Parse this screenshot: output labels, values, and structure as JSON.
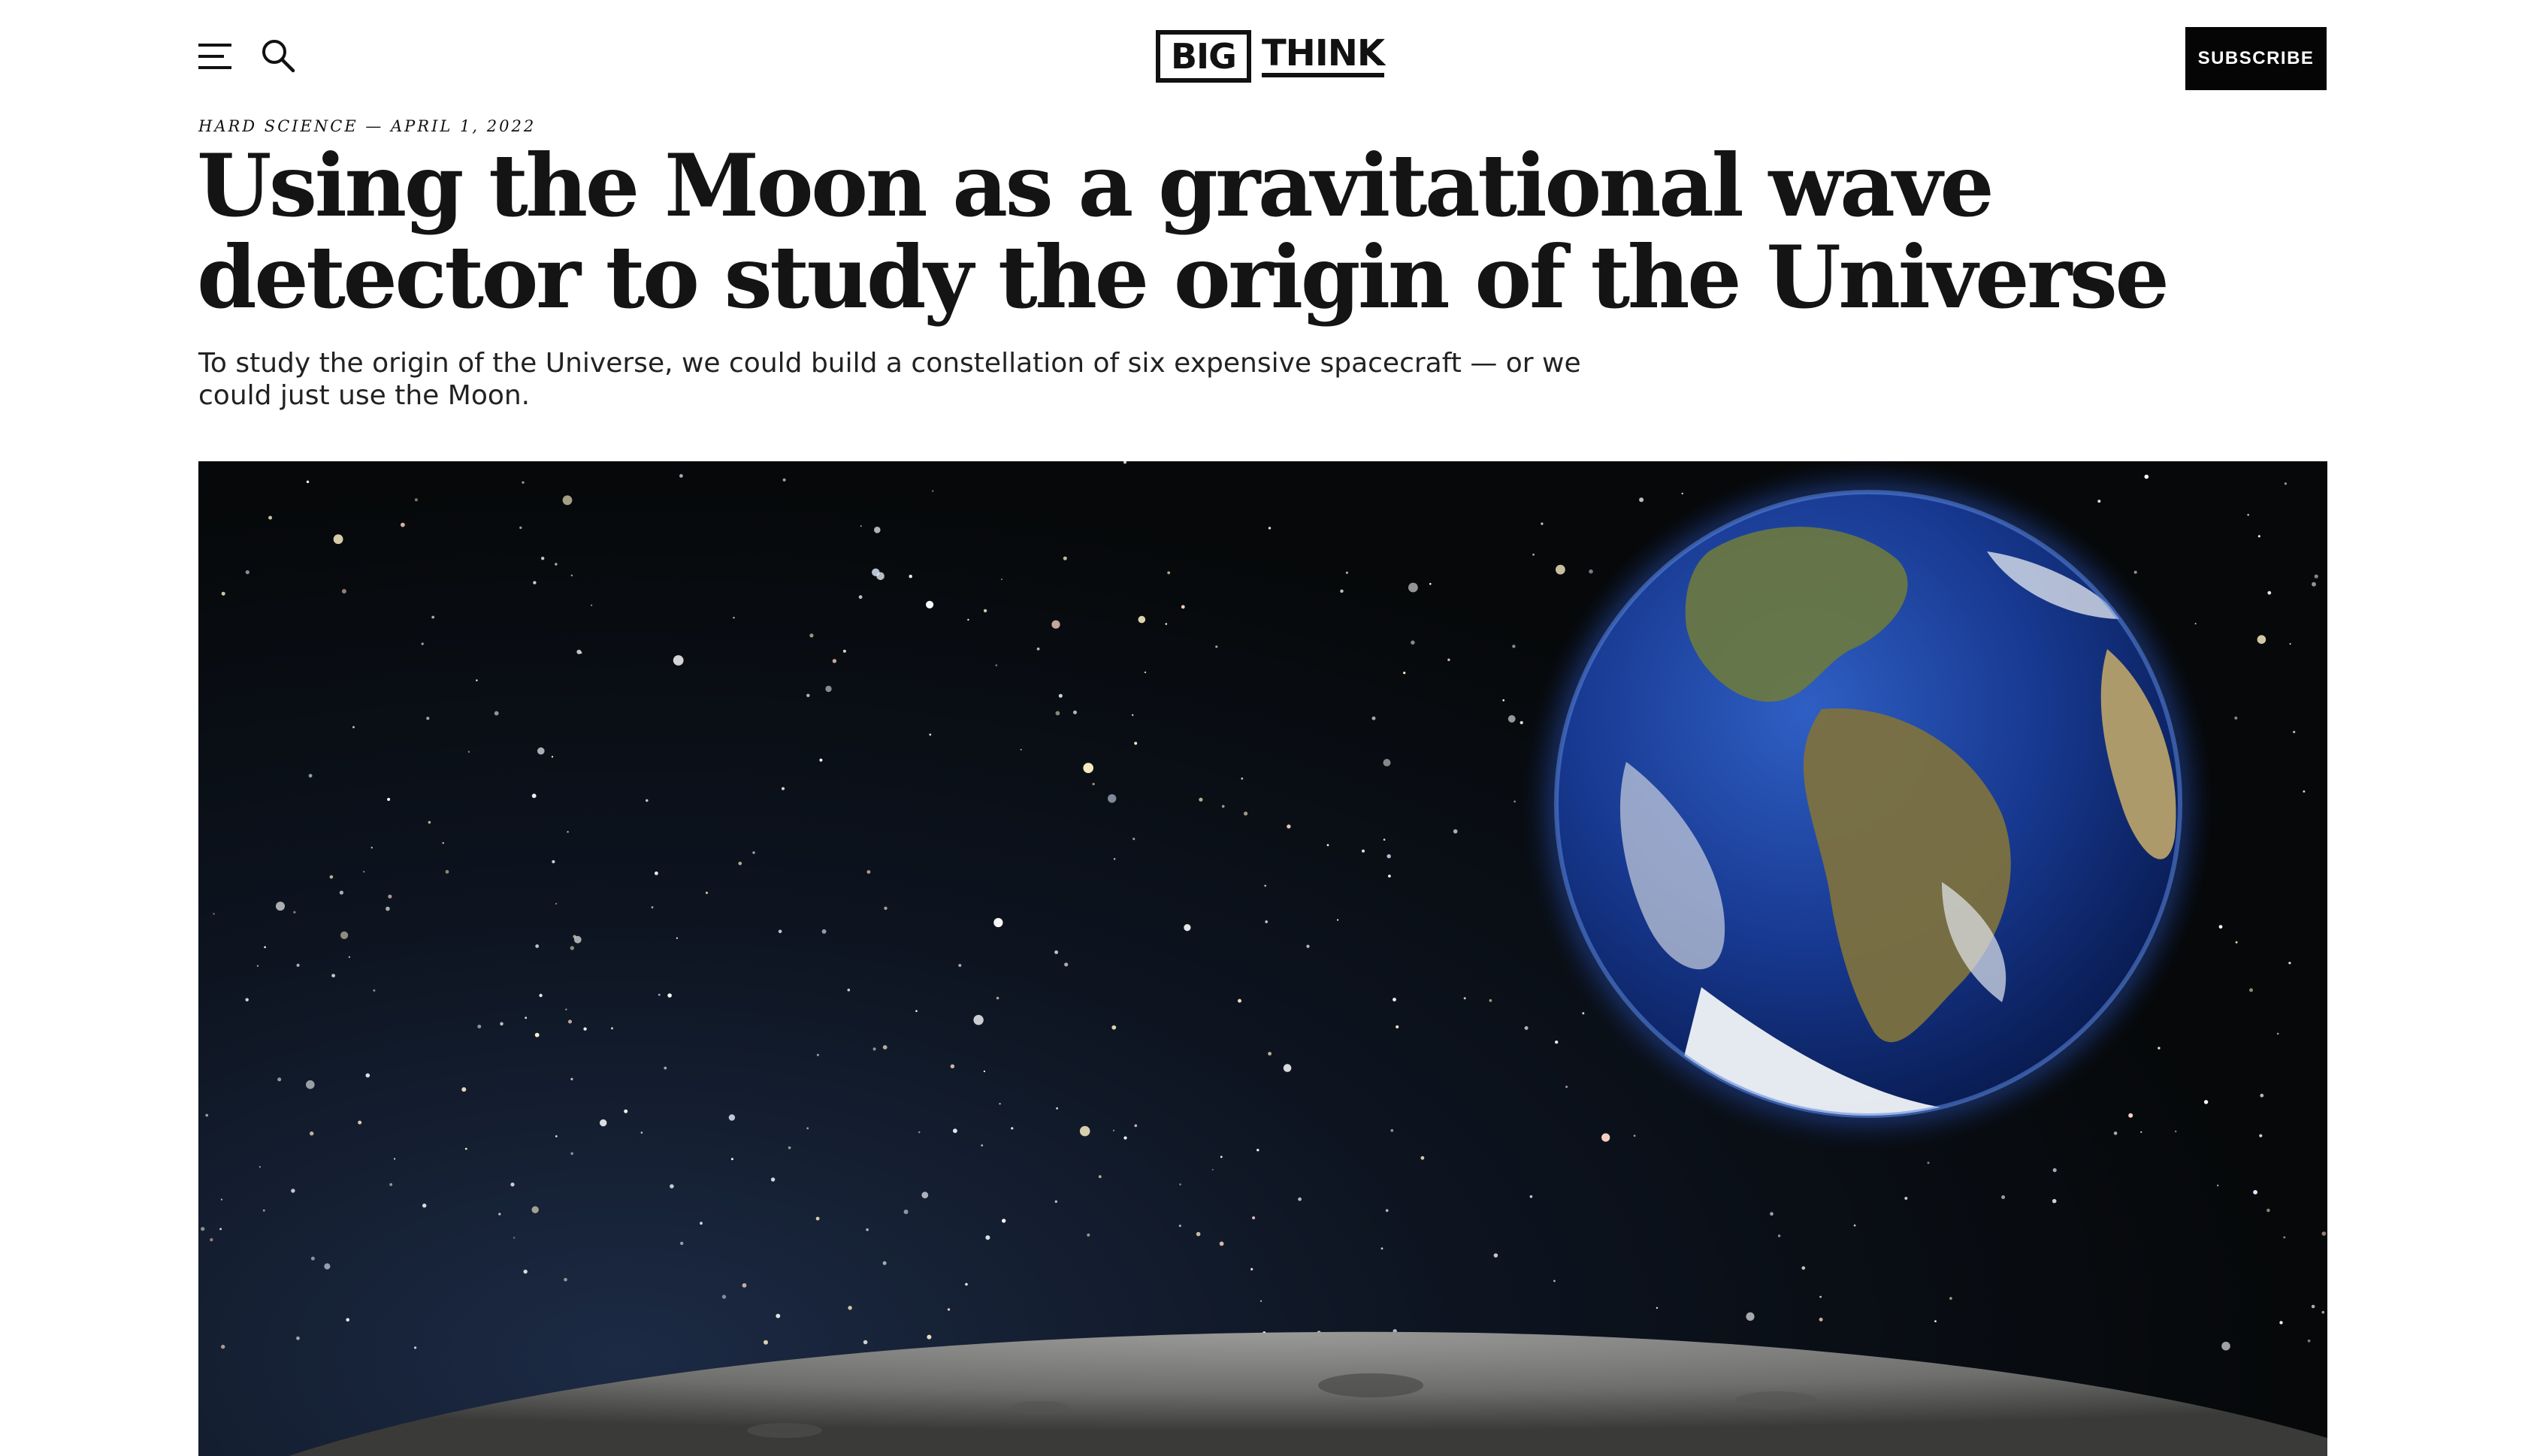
{
  "header": {
    "menu_icon": "hamburger-menu-icon",
    "search_icon": "search-icon",
    "logo": {
      "part1": "BIG",
      "part2": "THINK"
    },
    "subscribe_label": "SUBSCRIBE"
  },
  "article": {
    "category": "HARD SCIENCE",
    "separator": " — ",
    "date": "APRIL 1, 2022",
    "title": "Using the Moon as a gravitational wave detector to study the origin of the Universe",
    "dek": "To study the origin of the Universe, we could build a constellation of six expensive spacecraft — or we could just use the Moon."
  },
  "hero_image": {
    "alt": "Earth rising over the lunar surface against a starry sky"
  },
  "colors": {
    "text": "#141414",
    "subscribe_bg": "#050505",
    "space": "#060809"
  }
}
